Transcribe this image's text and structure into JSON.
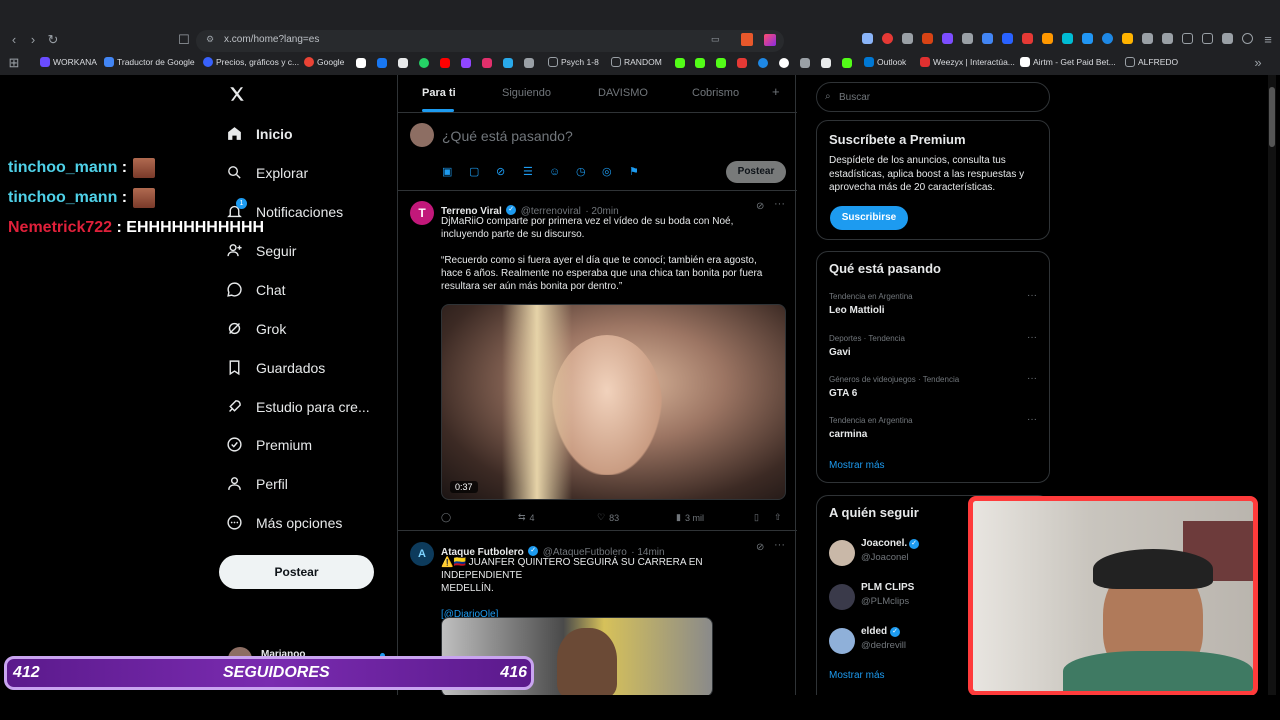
{
  "browser": {
    "url": "x.com/home?lang=es",
    "bookmarks": [
      {
        "label": "WORKANA",
        "color": "#6a4cff"
      },
      {
        "label": "Traductor de Google",
        "color": "#4285f4"
      },
      {
        "label": "Precios, gráficos y c...",
        "color": "#3861fb"
      },
      {
        "label": "Google",
        "color": "#ea4335"
      },
      {
        "label": "Psych 1-8",
        "color": "#9aa0a6"
      },
      {
        "label": "RANDOM",
        "color": "#9aa0a6"
      },
      {
        "label": "Outlook",
        "color": "#0078d4"
      },
      {
        "label": "Weezyx | Interactúa...",
        "color": "#e03030"
      },
      {
        "label": "Airtm - Get Paid Bet...",
        "color": "#ffffff"
      },
      {
        "label": "ALFREDO",
        "color": "#9aa0a6"
      }
    ]
  },
  "nav": {
    "items": [
      {
        "label": "Inicio",
        "icon": "home-icon"
      },
      {
        "label": "Explorar",
        "icon": "search-icon"
      },
      {
        "label": "Notificaciones",
        "icon": "bell-icon",
        "badge": "1"
      },
      {
        "label": "Seguir",
        "icon": "add-person-icon"
      },
      {
        "label": "Chat",
        "icon": "chat-icon"
      },
      {
        "label": "Grok",
        "icon": "grok-icon"
      },
      {
        "label": "Guardados",
        "icon": "bookmark-icon"
      },
      {
        "label": "Estudio para cre...",
        "icon": "rocket-icon"
      },
      {
        "label": "Premium",
        "icon": "verified-icon"
      },
      {
        "label": "Perfil",
        "icon": "person-icon"
      },
      {
        "label": "Más opciones",
        "icon": "more-circle-icon"
      }
    ],
    "post_label": "Postear",
    "account_name": "Marianoo"
  },
  "feed": {
    "tabs": [
      "Para ti",
      "Siguiendo",
      "DAVISMO",
      "Cobrismo"
    ],
    "compose_placeholder": "¿Qué está pasando?",
    "compose_post_label": "Postear",
    "tweets": [
      {
        "name": "Terreno Viral",
        "handle": "@terrenoviral",
        "time": "· 20min",
        "text1": "DjMaRiiO comparte por primera vez el vídeo de su boda con Noé,",
        "text2": "incluyendo parte de su discurso.",
        "quote1": "“Recuerdo como si fuera ayer el día que te conocí; también era agosto,",
        "quote2": "hace 6 años. Realmente no esperaba que una chica tan bonita por fuera",
        "quote3": "resultara ser aún más bonita por dentro.”",
        "video_duration": "0:37",
        "retweets": "4",
        "likes": "83",
        "views": "3 mil"
      },
      {
        "name": "Ataque Futbolero",
        "handle": "@AtaqueFutbolero",
        "time": "· 14min",
        "text1": "⚠️🇨🇴 JUANFER QUINTERO SEGUIRÁ SU CARRERA EN INDEPENDIENTE",
        "text2": "MEDELLÍN.",
        "mention": "[@DiarioOle]"
      }
    ]
  },
  "sidebar": {
    "search_placeholder": "Buscar",
    "premium": {
      "title": "Suscríbete a Premium",
      "line1": "Despídete de los anuncios, consulta tus",
      "line2": "estadísticas, aplica boost a las respuestas y",
      "line3": "aprovecha más de 20 características.",
      "button": "Suscribirse"
    },
    "trends": {
      "title": "Qué está pasando",
      "items": [
        {
          "meta": "Tendencia en Argentina",
          "name": "Leo Mattioli"
        },
        {
          "meta": "Deportes · Tendencia",
          "name": "Gavi"
        },
        {
          "meta": "Géneros de videojuegos · Tendencia",
          "name": "GTA 6"
        },
        {
          "meta": "Tendencia en Argentina",
          "name": "carmina"
        }
      ],
      "more": "Mostrar más"
    },
    "follow": {
      "title": "A quién seguir",
      "items": [
        {
          "name": "Joaconel.",
          "handle": "@Joaconel"
        },
        {
          "name": "PLM CLIPS",
          "handle": "@PLMclips"
        },
        {
          "name": "elded",
          "handle": "@dedrevill"
        }
      ],
      "more": "Mostrar más"
    }
  },
  "overlay": {
    "chat": [
      {
        "user": "tinchoo_mann",
        "sep": " :",
        "msg": "",
        "color": "#4fd1e8"
      },
      {
        "user": "tinchoo_mann",
        "sep": " :",
        "msg": "",
        "color": "#4fd1e8"
      },
      {
        "user": "Nemetrick722",
        "sep": " :",
        "msg": " EHHHHHHHHHHH",
        "color": "#e0203a"
      }
    ],
    "followers_current": "412",
    "followers_label": "SEGUIDORES",
    "followers_goal": "416"
  }
}
